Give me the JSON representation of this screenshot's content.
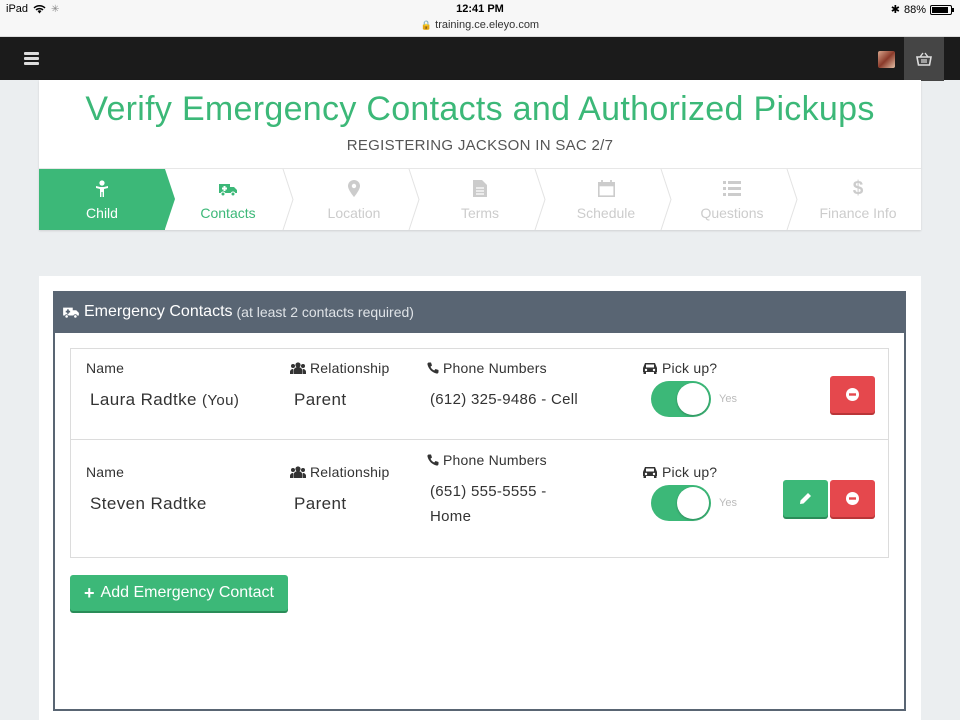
{
  "status_bar": {
    "device": "iPad",
    "time": "12:41 PM",
    "url": "training.ce.eleyo.com",
    "battery": "88%"
  },
  "nav": {
    "menu_icon": "hamburger-icon",
    "cart_icon": "basket-icon"
  },
  "header": {
    "title": "Verify Emergency Contacts and Authorized Pickups",
    "subtitle": "REGISTERING JACKSON IN SAC 2/7"
  },
  "steps": [
    {
      "label": "Child",
      "icon": "child-icon",
      "state": "active"
    },
    {
      "label": "Contacts",
      "icon": "ambulance-icon",
      "state": "done"
    },
    {
      "label": "Location",
      "icon": "map-marker-icon",
      "state": "pending"
    },
    {
      "label": "Terms",
      "icon": "file-icon",
      "state": "pending"
    },
    {
      "label": "Schedule",
      "icon": "calendar-icon",
      "state": "pending"
    },
    {
      "label": "Questions",
      "icon": "list-icon",
      "state": "pending"
    },
    {
      "label": "Finance Info",
      "icon": "dollar-icon",
      "state": "pending"
    }
  ],
  "panel": {
    "title": "Emergency Contacts",
    "note": "(at least 2 contacts required)"
  },
  "labels": {
    "name": "Name",
    "relationship": "Relationship",
    "phone": "Phone Numbers",
    "pickup": "Pick up?",
    "toggle_on": "Yes"
  },
  "contacts": [
    {
      "name": "Laura Radtke",
      "suffix": "(You)",
      "relationship": "Parent",
      "phone": "(612) 325-9486 - Cell",
      "pickup": true,
      "editable": false
    },
    {
      "name": "Steven Radtke",
      "suffix": "",
      "relationship": "Parent",
      "phone_line1": "(651) 555-5555 -",
      "phone_line2": "Home",
      "pickup": true,
      "editable": true
    }
  ],
  "add_button": "Add Emergency Contact",
  "colors": {
    "primary": "#3cb878",
    "danger": "#e5484d",
    "panel_header": "#596573",
    "navbar": "#1b1b1b"
  }
}
